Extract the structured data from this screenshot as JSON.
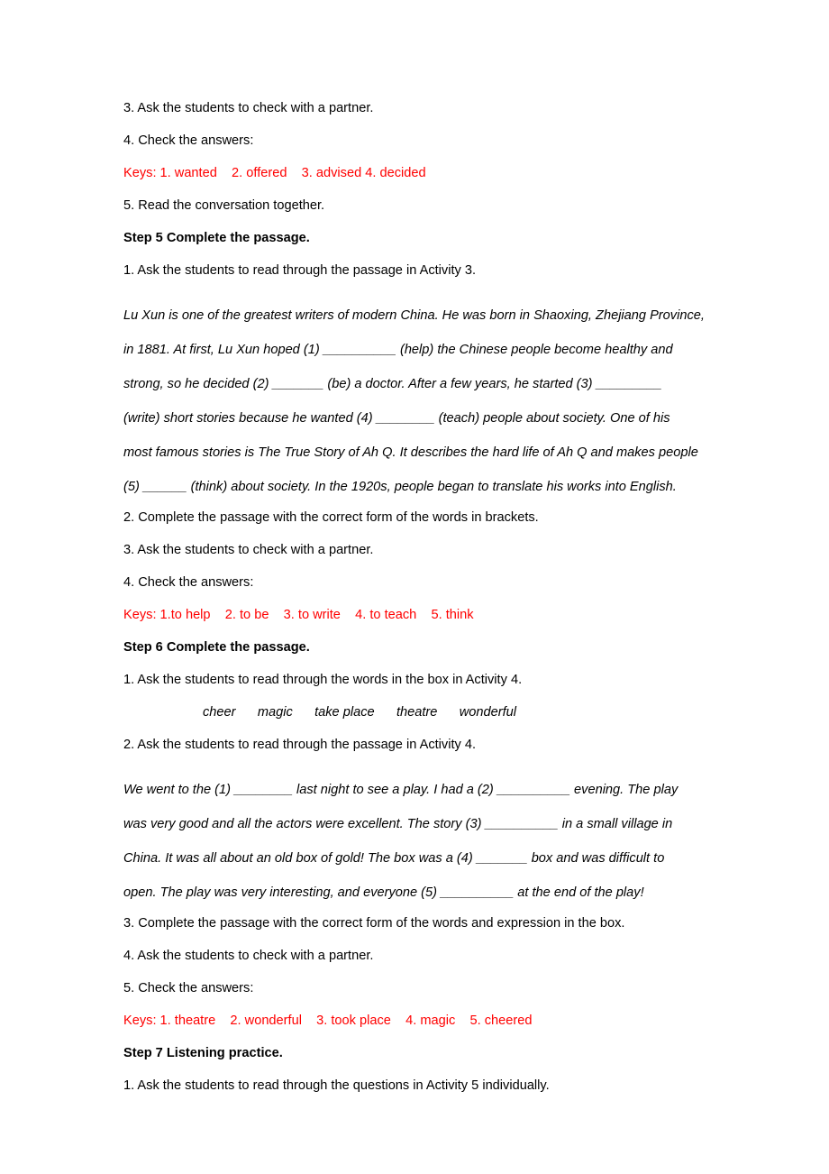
{
  "document": {
    "page_background": "#ffffff",
    "key_color": "#ff0000",
    "text_color": "#000000"
  },
  "blocks": {
    "line_ask_check_partner_1": "3. Ask the students to check with a partner.",
    "line_check_answers_1": "4. Check the answers:",
    "keys_1": "Keys: 1. wanted    2. offered    3. advised 4. decided",
    "line_read_conversation": "5. Read the conversation together.",
    "step5_heading": "Step 5 Complete the passage.",
    "step5_item1": "1. Ask the students to read through the passage in Activity 3.",
    "passage1": {
      "line1": "Lu Xun is one of the greatest writers of modern China. He was born in Shaoxing, Zhejiang Province,",
      "line2": "in 1881. At first, Lu Xun hoped (1) __________ (help) the Chinese people become healthy and",
      "line3": "strong, so he decided (2) _______ (be) a doctor. After a few years, he started (3) _________",
      "line4": "(write) short stories because he wanted (4) ________ (teach) people about society. One of his",
      "line5": "most famous stories is The True Story of Ah Q. It describes the hard life of Ah Q and makes people",
      "line6": "(5) ______ (think) about society. In the 1920s, people began to translate his works into English."
    },
    "step5_item2": "2. Complete the passage with the correct form of the words in brackets.",
    "step5_item3": "3. Ask the students to check with a partner.",
    "step5_item4": "4. Check the answers:",
    "keys_2": "Keys: 1.to help    2. to be    3. to write    4. to teach    5. think",
    "step6_heading": "Step 6 Complete the passage.",
    "step6_item1": "1. Ask the students to read through the words in the box in Activity 4.",
    "word_bank": {
      "words": [
        "cheer",
        "magic",
        "take place",
        "theatre",
        "wonderful"
      ],
      "text": "cheer      magic      take place      theatre      wonderful"
    },
    "step6_item2": "2. Ask the students to read through the passage in Activity 4.",
    "passage2": {
      "line1": "We went to the (1) ________ last night to see a play. I had a (2) __________ evening. The play",
      "line2": "was very good and all the actors were excellent. The story (3) __________ in a small village in",
      "line3": "China. It was all about an old box of gold! The box was a (4) _______ box and was difficult to",
      "line4": "open. The play was very interesting, and everyone (5) __________ at the end of the play!"
    },
    "step6_item3": "3. Complete the passage with the correct form of the words and expression in the box.",
    "step6_item4": "4. Ask the students to check with a partner.",
    "step6_item5": "5. Check the answers:",
    "keys_3": "Keys: 1. theatre    2. wonderful    3. took place    4. magic    5. cheered",
    "step7_heading": "Step 7 Listening practice.",
    "step7_item1": "1. Ask the students to read through the questions in Activity 5 individually."
  }
}
